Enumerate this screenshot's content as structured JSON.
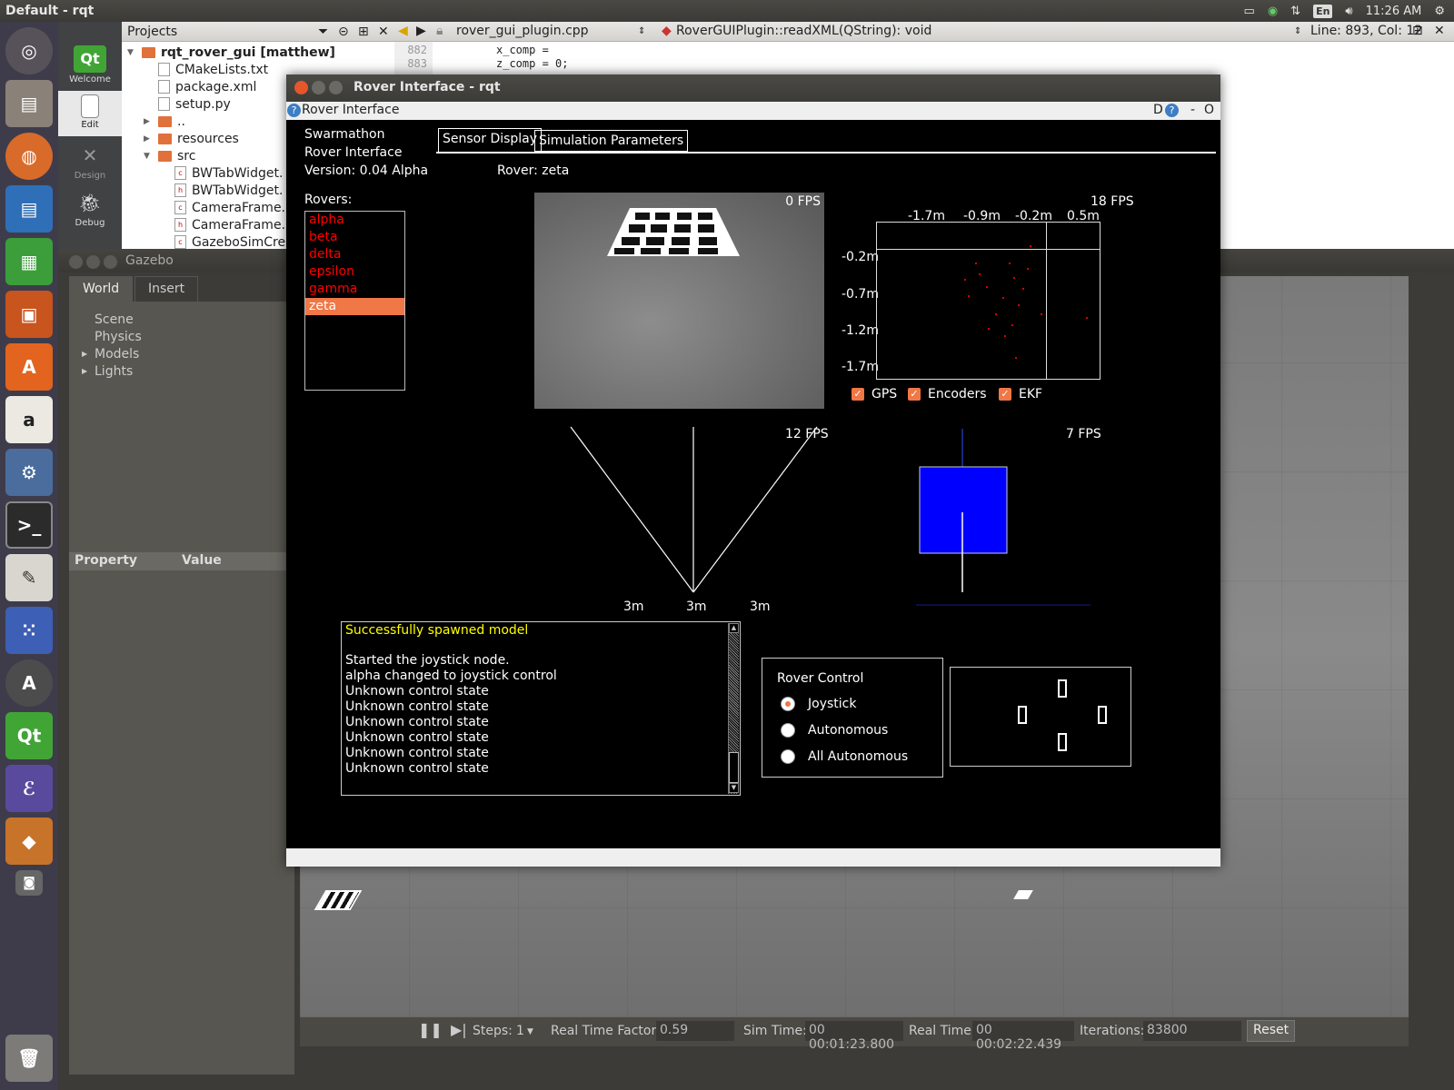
{
  "top_panel": {
    "window_title": "Default - rqt",
    "keyboard_layout": "En",
    "clock": "11:26 AM"
  },
  "launcher": {
    "items": [
      "ubuntu-dash-icon",
      "files-icon",
      "firefox-icon",
      "writer-icon",
      "calc-icon",
      "impress-icon",
      "software-center-icon",
      "amazon-icon",
      "system-settings-icon",
      "terminal-icon",
      "text-editor-icon",
      "app-grid-icon",
      "updater-icon",
      "qt-creator-icon",
      "emacs-icon",
      "virtualbox-icon",
      "screenshot-icon",
      "trash-icon"
    ]
  },
  "qt_creator": {
    "modes": [
      {
        "label": "Welcome"
      },
      {
        "label": "Edit"
      },
      {
        "label": "Design"
      },
      {
        "label": "Debug"
      }
    ],
    "projects_label": "Projects",
    "tree": {
      "project": "rqt_rover_gui [matthew]",
      "files": [
        "CMakeLists.txt",
        "package.xml",
        "setup.py"
      ],
      "dotdot": "..",
      "resources": "resources",
      "src": "src",
      "src_files": [
        "BWTabWidget.",
        "BWTabWidget.",
        "CameraFrame.",
        "CameraFrame.",
        "GazeboSimCre"
      ]
    },
    "editor": {
      "file": "rover_gui_plugin.cpp",
      "symbol": "RoverGUIPlugin::readXML(QString): void",
      "position": "Line: 893, Col: 12",
      "line_numbers": [
        "882",
        "883"
      ],
      "code": [
        "x_comp =",
        "z_comp = 0;"
      ]
    }
  },
  "gazebo": {
    "title": "Gazebo",
    "tabs": [
      "World",
      "Insert"
    ],
    "tree": [
      "Scene",
      "Physics",
      "Models",
      "Lights"
    ],
    "prop_header": {
      "property": "Property",
      "value": "Value"
    },
    "bottom": {
      "steps_label": "Steps:",
      "steps_value": "1",
      "rtf_label": "Real Time Factor:",
      "rtf_value": "0.59",
      "sim_time_label": "Sim Time:",
      "sim_time_value": "00 00:01:23.800",
      "real_time_label": "Real Time:",
      "real_time_value": "00 00:02:22.439",
      "iterations_label": "Iterations:",
      "iterations_value": "83800",
      "reset": "Reset"
    }
  },
  "rqt": {
    "title": "Rover Interface - rqt",
    "dock_title": "Rover Interface",
    "dock_buttons": {
      "d": "D",
      "dash": "-",
      "close": "O"
    },
    "app_name_1": "Swarmathon",
    "app_name_2": "Rover Interface",
    "version": "Version:  0.04 Alpha",
    "tabs": [
      "Sensor Display",
      "Simulation Parameters"
    ],
    "rover_label": "Rover: zeta",
    "rovers_label": "Rovers:",
    "rovers": [
      "alpha",
      "beta",
      "delta",
      "epsilon",
      "gamma",
      "zeta"
    ],
    "selected_rover": "zeta",
    "camera_fps": "0 FPS",
    "map_fps": "18 FPS",
    "map_x_ticks": [
      "-1.7m",
      "-0.9m",
      "-0.2m",
      "0.5m"
    ],
    "map_y_ticks": [
      "-0.2m",
      "-0.7m",
      "-1.2m",
      "-1.7m"
    ],
    "checkboxes": [
      {
        "label": "GPS",
        "checked": true
      },
      {
        "label": "Encoders",
        "checked": true
      },
      {
        "label": "EKF",
        "checked": true
      }
    ],
    "sonar_fps": "12 FPS",
    "sonar_ranges": [
      "3m",
      "3m",
      "3m"
    ],
    "imu_fps": "7 FPS",
    "log": {
      "first": "Successfully spawned model",
      "lines": [
        "Started the joystick node.",
        "alpha changed to joystick control",
        "Unknown control state",
        "Unknown control state",
        "Unknown control state",
        "Unknown control state",
        "Unknown control state",
        "Unknown control state"
      ]
    },
    "control": {
      "title": "Rover Control",
      "options": [
        "Joystick",
        "Autonomous",
        "All Autonomous"
      ],
      "selected": "Joystick"
    },
    "colors": {
      "accent": "#f07746",
      "rover_text": "#ff0000",
      "log_first": "#ffff00",
      "imu_box": "#0000ff"
    }
  }
}
